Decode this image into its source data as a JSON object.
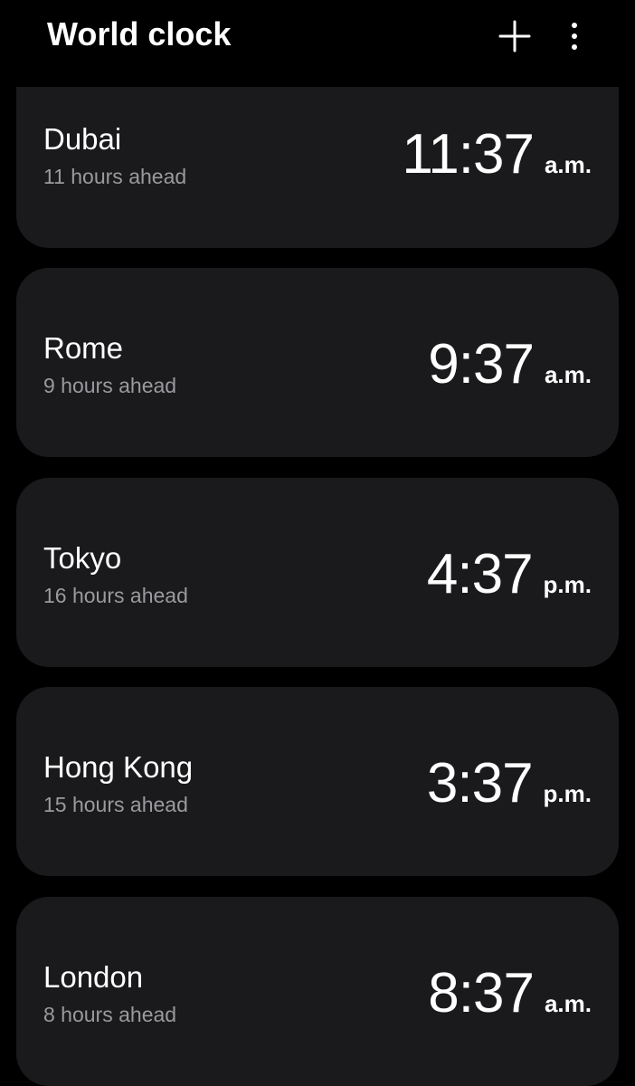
{
  "app": {
    "title": "World clock"
  },
  "toolbar": {
    "add_icon": "plus-icon",
    "more_icon": "more-vertical-icon"
  },
  "theme": {
    "background": "#000000",
    "card": "#1a1a1c",
    "text_primary": "#ffffff",
    "text_secondary": "#9a9a9e"
  },
  "clocks": [
    {
      "city": "Dubai",
      "offset": "11 hours ahead",
      "time": "11:37",
      "ampm": "a.m."
    },
    {
      "city": "Rome",
      "offset": "9 hours ahead",
      "time": "9:37",
      "ampm": "a.m."
    },
    {
      "city": "Tokyo",
      "offset": "16 hours ahead",
      "time": "4:37",
      "ampm": "p.m."
    },
    {
      "city": "Hong Kong",
      "offset": "15 hours ahead",
      "time": "3:37",
      "ampm": "p.m."
    },
    {
      "city": "London",
      "offset": "8 hours ahead",
      "time": "8:37",
      "ampm": "a.m."
    }
  ]
}
